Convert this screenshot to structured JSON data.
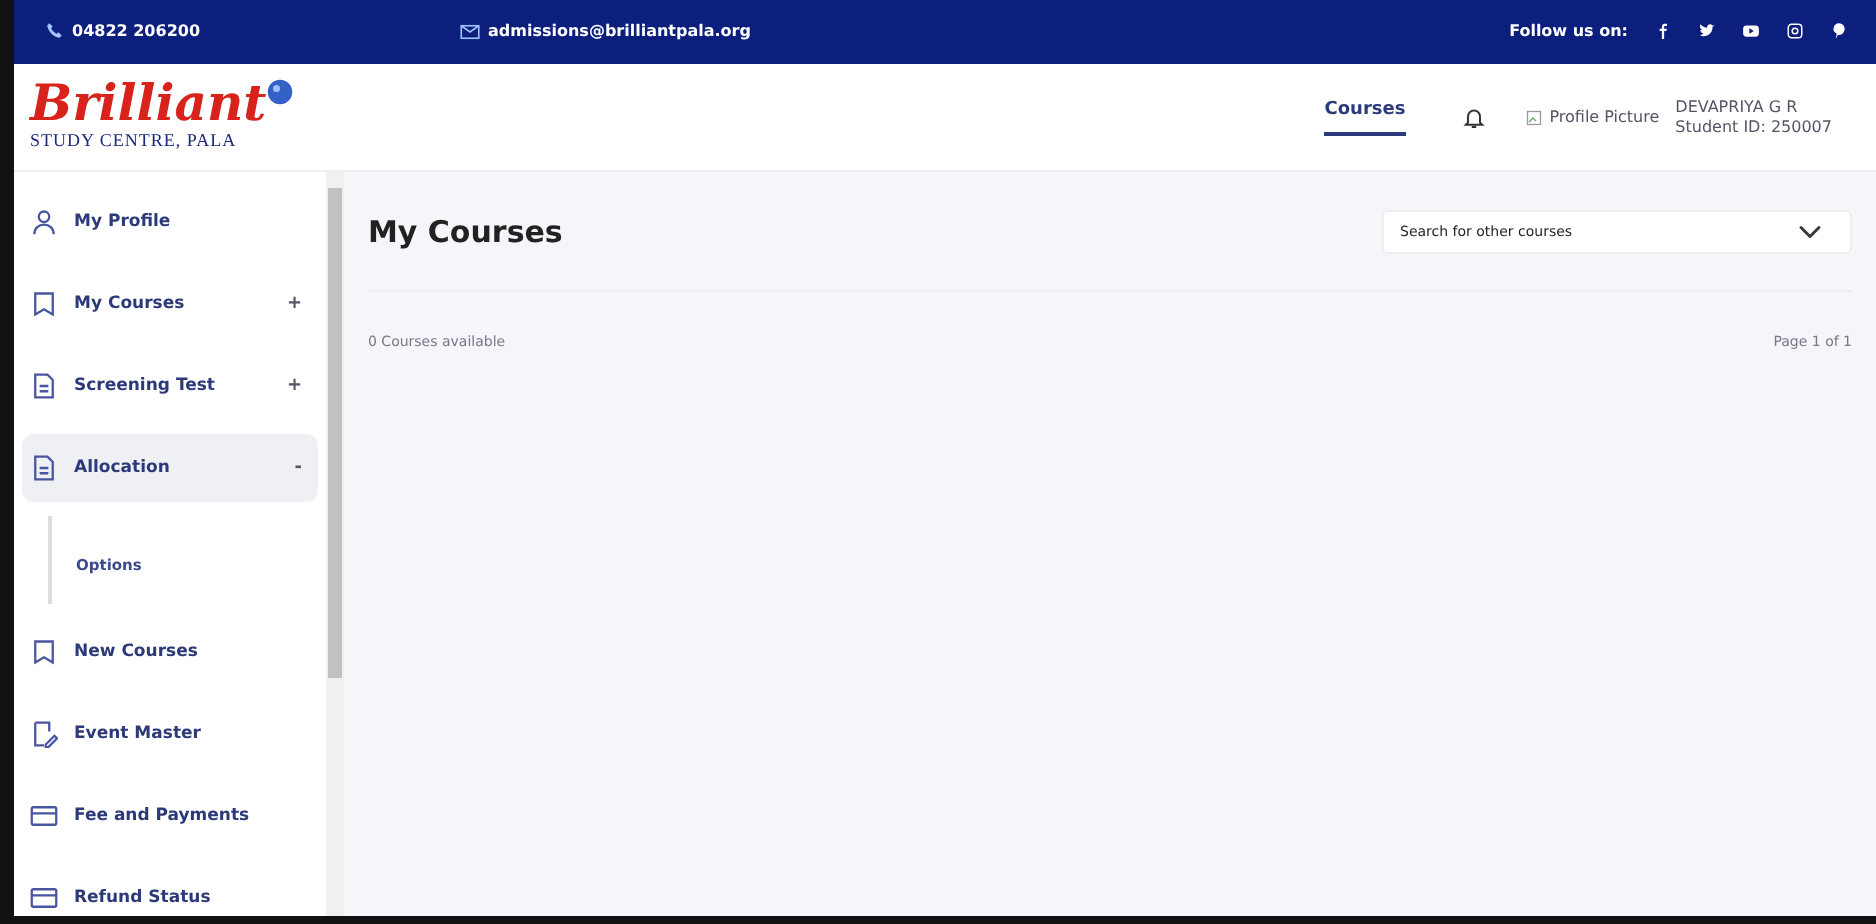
{
  "topbar": {
    "phone": "04822 206200",
    "email": "admissions@brilliantpala.org",
    "follow_label": "Follow us on:"
  },
  "header": {
    "logo": {
      "title": "Brilliant",
      "subtitle": "STUDY CENTRE, PALA"
    },
    "nav": [
      {
        "label": "Courses",
        "selected": true
      }
    ],
    "profile_picture_alt": "Profile Picture",
    "user_name": "DEVAPRIYA G R",
    "student_id": "Student ID: 250007"
  },
  "sidebar": {
    "items": [
      {
        "label": "My Profile",
        "kind": "person",
        "selected": false
      },
      {
        "label": "My Courses",
        "kind": "bookmark",
        "toggle": "+",
        "selected": false,
        "expanded": false
      },
      {
        "label": "Screening Test",
        "kind": "document",
        "toggle": "+",
        "selected": false,
        "expanded": false
      },
      {
        "label": "Allocation",
        "kind": "document",
        "toggle": "-",
        "selected": true,
        "expanded": true,
        "children": [
          {
            "label": "Options"
          }
        ]
      },
      {
        "label": "New Courses",
        "kind": "bookmark",
        "selected": false
      },
      {
        "label": "Event Master",
        "kind": "edit",
        "selected": false
      },
      {
        "label": "Fee and Payments",
        "kind": "card",
        "selected": false
      },
      {
        "label": "Refund Status",
        "kind": "card",
        "selected": false
      }
    ]
  },
  "main": {
    "title": "My Courses",
    "search": {
      "placeholder": "Search for other courses"
    },
    "count": "0 Courses available",
    "page": "Page 1 of 1"
  }
}
